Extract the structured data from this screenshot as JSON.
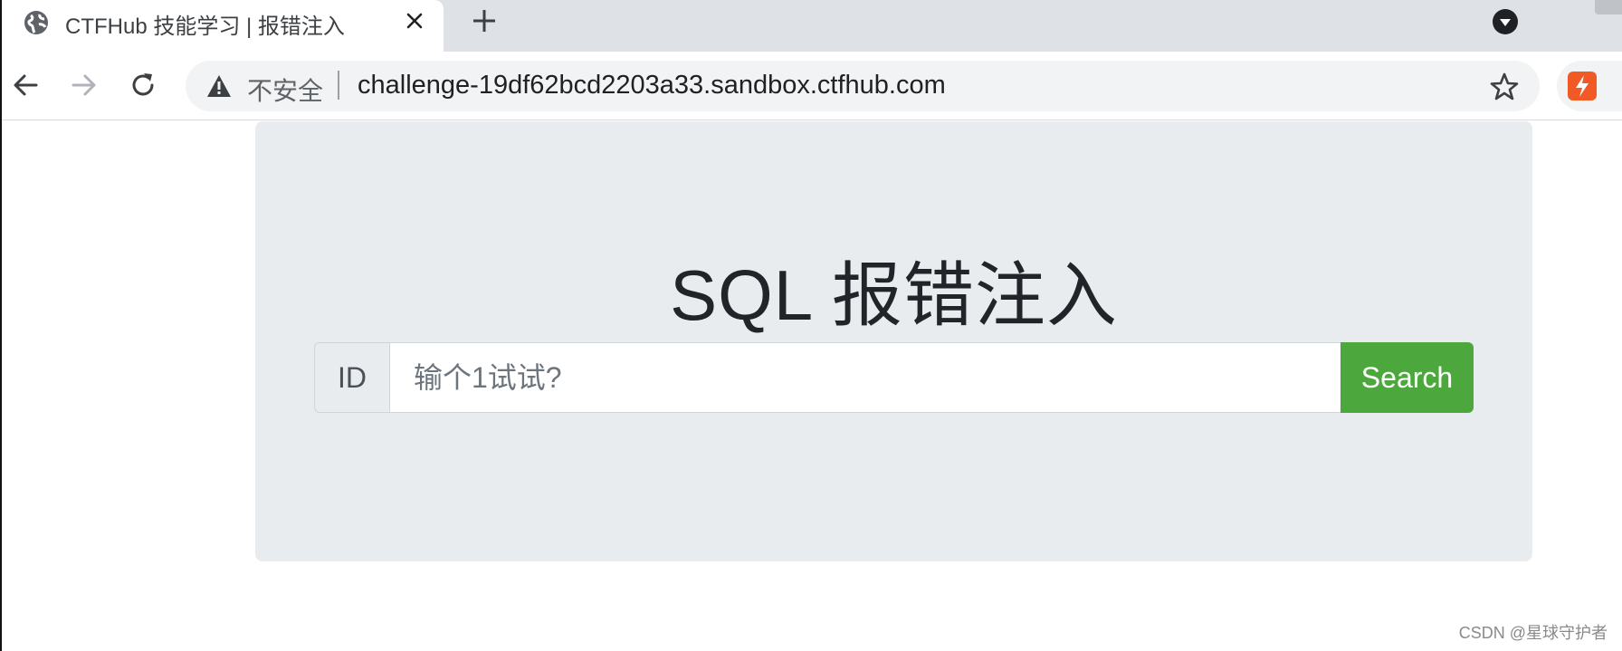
{
  "browser": {
    "tab": {
      "title": "CTFHub 技能学习 | 报错注入",
      "favicon": "globe-icon"
    },
    "toolbar": {
      "security_label": "不安全",
      "url": "challenge-19df62bcd2203a33.sandbox.ctfhub.com"
    },
    "icons": {
      "back": "arrow-left-icon",
      "forward": "arrow-right-icon",
      "reload": "reload-icon",
      "warning": "warning-triangle-icon",
      "bookmark": "star-icon",
      "new_tab": "plus-icon",
      "close_tab": "close-icon",
      "tab_search": "chevron-down-circle-icon",
      "extension": "lightning-extension-icon"
    }
  },
  "page": {
    "heading": "SQL 报错注入",
    "form": {
      "prefix_label": "ID",
      "input_placeholder": "输个1试试?",
      "input_value": "",
      "button_label": "Search"
    }
  },
  "watermark": "CSDN @星球守护者",
  "colors": {
    "jumbotron_bg": "#e9ecef",
    "search_button": "#4ca83c",
    "extension_icon": "#f15a24",
    "tabstrip_bg": "#dee1e6"
  }
}
